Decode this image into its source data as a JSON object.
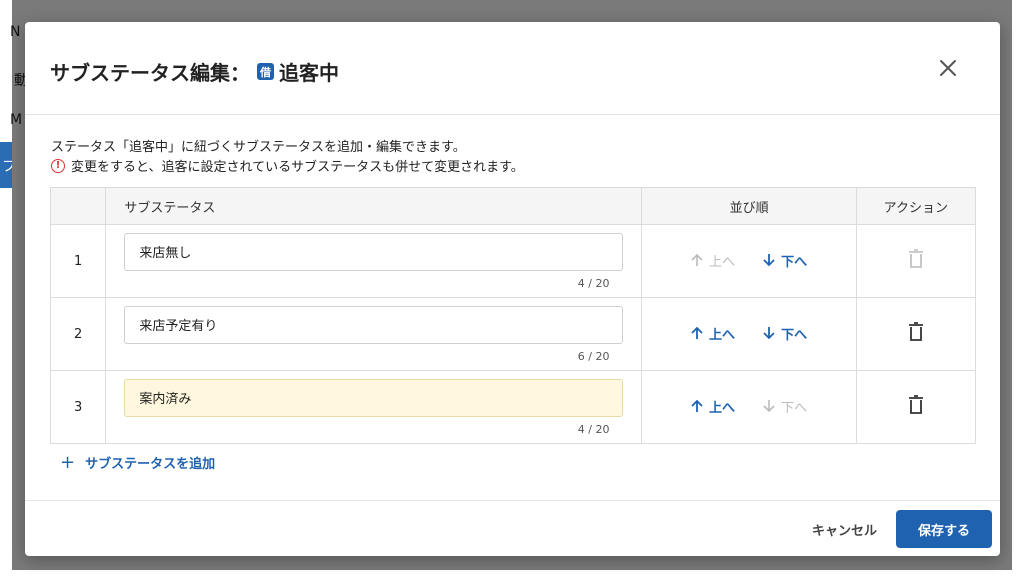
{
  "background": {
    "text_top": "N",
    "text_mid": "動",
    "text_low": "M",
    "text_side": "フ"
  },
  "modal": {
    "title_prefix": "サブステータス編集：",
    "badge_label": "借",
    "status_name": "追客中",
    "close_icon": "close-icon",
    "description": "ステータス「追客中」に紐づくサブステータスを追加・編集できます。",
    "warning": "変更をすると、追客に設定されているサブステータスも併せて変更されます。",
    "warning_icon": "!",
    "table": {
      "headers": {
        "number": "",
        "name": "サブステータス",
        "order": "並び順",
        "action": "アクション"
      },
      "rows": [
        {
          "number": "1",
          "value": "来店無し",
          "counter": "4 / 20",
          "up_enabled": false,
          "down_enabled": true,
          "highlighted": false,
          "delete_enabled": false
        },
        {
          "number": "2",
          "value": "来店予定有り",
          "counter": "6 / 20",
          "up_enabled": true,
          "down_enabled": true,
          "highlighted": false,
          "delete_enabled": true
        },
        {
          "number": "3",
          "value": "案内済み",
          "counter": "4 / 20",
          "up_enabled": true,
          "down_enabled": false,
          "highlighted": true,
          "delete_enabled": true
        }
      ],
      "up_label": "上へ",
      "down_label": "下へ"
    },
    "add_label": "サブステータスを追加",
    "add_icon": "+",
    "cancel_label": "キャンセル",
    "save_label": "保存する"
  },
  "colors": {
    "accent": "#1f63b0",
    "disabled": "#bbbbbb",
    "highlight": "#fff8de",
    "warning": "#dd3333"
  }
}
